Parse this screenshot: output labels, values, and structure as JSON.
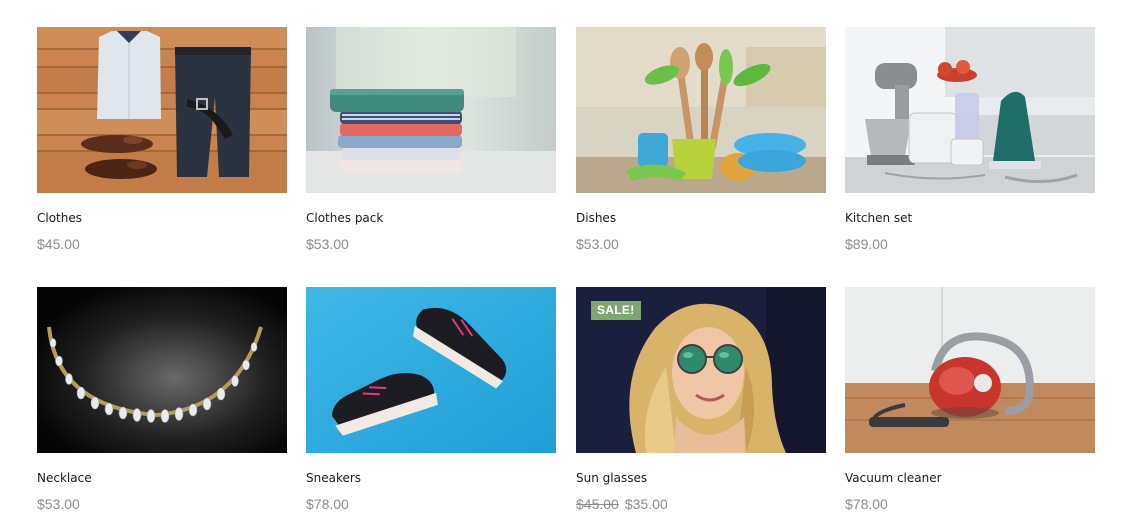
{
  "products": [
    {
      "name": "Clothes",
      "price": "$45.00",
      "image": "clothes-flatlay-image"
    },
    {
      "name": "Clothes pack",
      "price": "$53.00",
      "image": "folded-clothes-image"
    },
    {
      "name": "Dishes",
      "price": "$53.00",
      "image": "kitchen-utensils-image"
    },
    {
      "name": "Kitchen set",
      "price": "$89.00",
      "image": "kitchen-appliances-image"
    },
    {
      "name": "Necklace",
      "price": "$53.00",
      "image": "necklace-image"
    },
    {
      "name": "Sneakers",
      "price": "$78.00",
      "image": "sneakers-image"
    },
    {
      "name": "Sun glasses",
      "price_old": "$45.00",
      "price": "$35.00",
      "badge": "SALE!",
      "image": "sunglasses-woman-image"
    },
    {
      "name": "Vacuum cleaner",
      "price": "$78.00",
      "image": "vacuum-cleaner-image"
    }
  ],
  "colors": {
    "sale_badge": "#7ea670",
    "price_text": "#8c8c8c",
    "name_text": "#1a1a1a"
  }
}
